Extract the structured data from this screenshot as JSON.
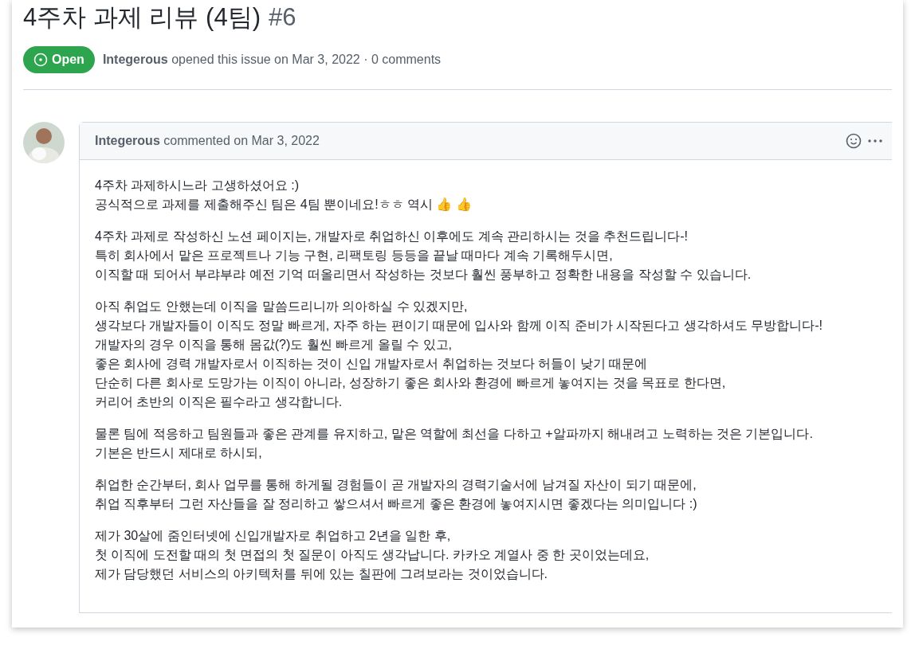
{
  "issue": {
    "title": "4주차 과제 리뷰 (4팀)",
    "number": "#6",
    "state": {
      "label": "Open",
      "open": true
    },
    "author": "Integerous",
    "meta": "opened this issue on Mar 3, 2022 · 0 comments"
  },
  "comment": {
    "author": "Integerous",
    "meta": "commented on Mar 3, 2022",
    "paragraphs": [
      {
        "lines": [
          "4주차 과제하시느라 고생하셨어요 :)",
          "공식적으로 과제를 제출해주신 팀은 4팀 뿐이네요!ㅎㅎ 역시 👍 👍"
        ]
      },
      {
        "lines": [
          "4주차 과제로 작성하신 노션 페이지는, 개발자로 취업하신 이후에도 계속 관리하시는 것을 추천드립니다-!",
          "특히 회사에서 맡은 프로젝트나 기능 구현, 리팩토링 등등을 끝날 때마다 계속 기록해두시면,",
          "이직할 때 되어서 부랴부랴 예전 기억 떠올리면서 작성하는 것보다 훨씬 풍부하고 정확한 내용을 작성할 수 있습니다."
        ]
      },
      {
        "lines": [
          "아직 취업도 안했는데 이직을 말씀드리니까 의아하실 수 있겠지만,",
          "생각보다 개발자들이 이직도 정말 빠르게, 자주 하는 편이기 때문에 입사와 함께 이직 준비가 시작된다고 생각하셔도 무방합니다-!",
          "개발자의 경우 이직을 통해 몸값(?)도 훨씬 빠르게 올릴 수 있고,",
          "좋은 회사에 경력 개발자로서 이직하는 것이 신입 개발자로서 취업하는 것보다 허들이 낮기 때문에",
          "단순히 다른 회사로 도망가는 이직이 아니라, 성장하기 좋은 회사와 환경에 빠르게 놓여지는 것을 목표로 한다면,",
          "커리어 초반의 이직은 필수라고 생각합니다."
        ]
      },
      {
        "lines": [
          "물론 팀에 적응하고 팀원들과 좋은 관계를 유지하고, 맡은 역할에 최선을 다하고 +알파까지 해내려고 노력하는 것은 기본입니다.",
          "기본은 반드시 제대로 하시되,"
        ]
      },
      {
        "lines": [
          "취업한 순간부터, 회사 업무를 통해 하게될 경험들이 곧 개발자의 경력기술서에 남겨질 자산이 되기 때문에,",
          "취업 직후부터 그런 자산들을 잘 정리하고 쌓으셔서 빠르게 좋은 환경에 놓여지시면 좋겠다는 의미입니다 :)"
        ]
      },
      {
        "lines": [
          "제가 30살에 줌인터넷에 신입개발자로 취업하고 2년을 일한 후,",
          "첫 이직에 도전할 때의 첫 면접의 첫 질문이 아직도 생각납니다. 카카오 계열사 중 한 곳이었는데요,",
          "제가 담당했던 서비스의 아키텍처를 뒤에 있는 칠판에 그려보라는 것이었습니다."
        ]
      }
    ]
  }
}
